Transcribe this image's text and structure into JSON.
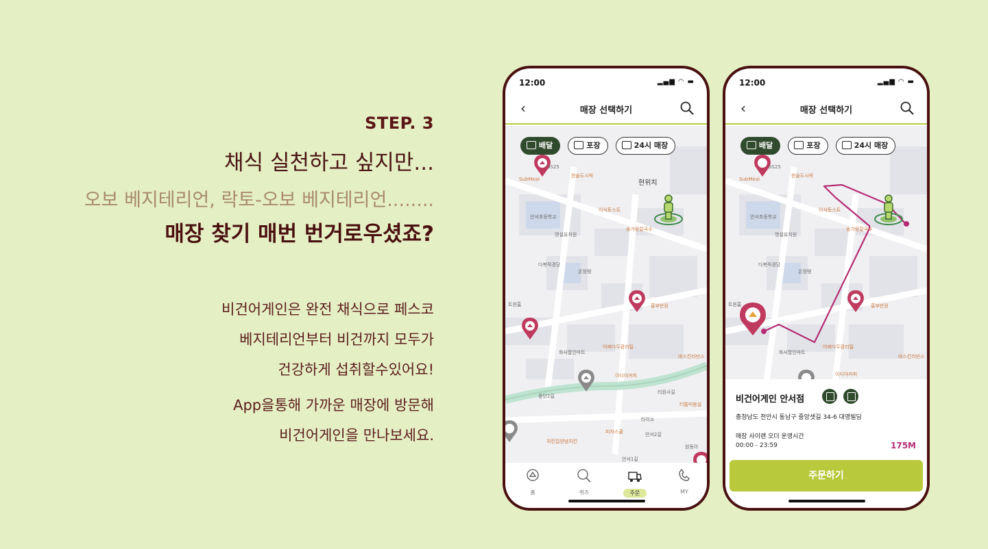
{
  "left_copy": {
    "step": "STEP. 3",
    "headline": "채식 실천하고 싶지만...",
    "sub": "오보 베지테리언, 락토-오보 베지테리언........",
    "strong": "매장 찾기 매번 번거로우셨죠?",
    "body_lines": [
      "비건어게인은 완전 채식으로 페스코",
      "베지테리언부터 비건까지 모두가",
      "건강하게 섭취할수있어요!"
    ],
    "body2_lines": [
      "App을통해 가까운 매장에 방문해",
      "비건어게인을 만나보세요."
    ]
  },
  "colors": {
    "background": "#e5efc4",
    "phone_frame": "#4a1010",
    "accent_green": "#b8c93c",
    "dark_green": "#2f4a2c",
    "pin": "#c0395f",
    "route": "#b52c73"
  },
  "phone1": {
    "status_time": "12:00",
    "nav_title": "매장 선택하기",
    "chips": [
      "배달",
      "포장",
      "24시 매장"
    ],
    "map_labels": [
      "SubMeal",
      "한솥도시락",
      "GS25",
      "현위치",
      "안서초등학교",
      "이삭토스트",
      "숭가랑칼국수",
      "명설유치원",
      "다복적경당",
      "온정탱",
      "트윈홈",
      "홍부반원",
      "화사할인마트",
      "어쩌다두환리틸",
      "이디야커피",
      "바스킨라빈스",
      "중당2길",
      "리원사길",
      "타이소",
      "피자스쿨",
      "안서2길",
      "터틀미용실",
      "처킨집양념치킨",
      "안서1길",
      "원동아"
    ],
    "tabs": [
      {
        "label": "홈",
        "icon": "home-icon"
      },
      {
        "label": "퀴즈",
        "icon": "quiz-icon"
      },
      {
        "label": "주문",
        "icon": "order-icon"
      },
      {
        "label": "MY",
        "icon": "my-icon"
      }
    ]
  },
  "phone2": {
    "status_time": "12:00",
    "nav_title": "매장 선택하기",
    "chips": [
      "배달",
      "포장",
      "24시 매장"
    ],
    "map_labels": [
      "SubMeal",
      "한솥도시락",
      "GS25",
      "안서초등학교",
      "이삭토스트",
      "숭가랑칼국수",
      "명설유치원",
      "다복적경당",
      "온정탱",
      "트윈홈",
      "홍부반원",
      "화사할인마트",
      "어쩌다두환리틸",
      "이디야커피",
      "바스킨라빈스"
    ],
    "store_name": "비건어게인 안서점",
    "address": "충청남도 천안시 동남구 중앙셋길 34-6 대영빌딩",
    "hours_label": "매장 사이렌 오더 운영시간",
    "hours_value": "00:00 - 23:59",
    "distance": "175M",
    "order_button": "주문하기"
  }
}
